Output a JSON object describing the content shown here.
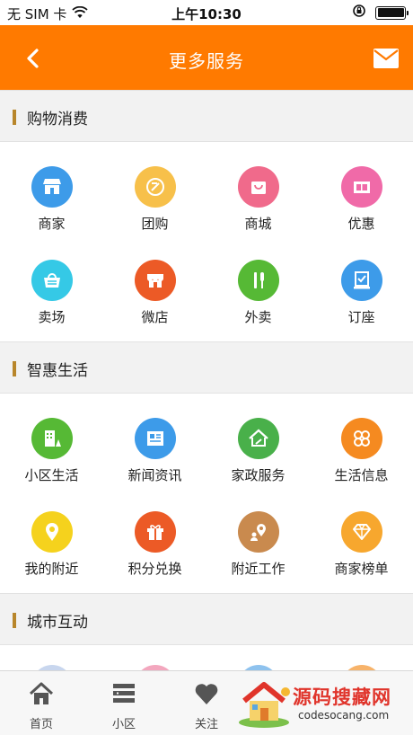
{
  "status_bar": {
    "carrier": "无 SIM 卡",
    "time": "上午10:30",
    "icons": [
      "wifi-icon",
      "rotation-lock-icon",
      "battery-icon"
    ]
  },
  "nav": {
    "title": "更多服务",
    "back_icon": "chevron-left-icon",
    "right_icon": "mail-icon"
  },
  "sections": [
    {
      "title": "购物消费",
      "items": [
        {
          "label": "商家",
          "icon": "store-icon",
          "color": "#3d9be9"
        },
        {
          "label": "团购",
          "icon": "discount-tag-icon",
          "color": "#f7c04a"
        },
        {
          "label": "商城",
          "icon": "shopping-bag-icon",
          "color": "#f06a8b"
        },
        {
          "label": "优惠",
          "icon": "coupon-icon",
          "color": "#f06aa8"
        },
        {
          "label": "卖场",
          "icon": "basket-icon",
          "color": "#35c9e6"
        },
        {
          "label": "微店",
          "icon": "shop-front-icon",
          "color": "#ec5a26"
        },
        {
          "label": "外卖",
          "icon": "fork-knife-icon",
          "color": "#56b935"
        },
        {
          "label": "订座",
          "icon": "reserve-seat-icon",
          "color": "#3d9be9"
        }
      ]
    },
    {
      "title": "智惠生活",
      "items": [
        {
          "label": "小区生活",
          "icon": "community-building-icon",
          "color": "#56b935"
        },
        {
          "label": "新闻资讯",
          "icon": "newspaper-icon",
          "color": "#3d9be9"
        },
        {
          "label": "家政服务",
          "icon": "house-clean-icon",
          "color": "#49b04a"
        },
        {
          "label": "生活信息",
          "icon": "clover-icon",
          "color": "#f58a20"
        },
        {
          "label": "我的附近",
          "icon": "location-pin-icon",
          "color": "#f5d21d"
        },
        {
          "label": "积分兑换",
          "icon": "gift-icon",
          "color": "#ec5a26"
        },
        {
          "label": "附近工作",
          "icon": "job-location-icon",
          "color": "#c98a4e"
        },
        {
          "label": "商家榜单",
          "icon": "diamond-icon",
          "color": "#f7a72e"
        }
      ]
    },
    {
      "title": "城市互动",
      "items": []
    }
  ],
  "tabbar": {
    "items": [
      {
        "label": "首页",
        "icon": "home-icon"
      },
      {
        "label": "小区",
        "icon": "list-icon"
      },
      {
        "label": "关注",
        "icon": "heart-icon"
      }
    ]
  },
  "watermark": {
    "brand": "源码搜藏网",
    "domain": "codesocang.com"
  },
  "colors": {
    "primary": "#ff7a00",
    "section_bar": "#b8862b",
    "background": "#f2f2f2"
  }
}
